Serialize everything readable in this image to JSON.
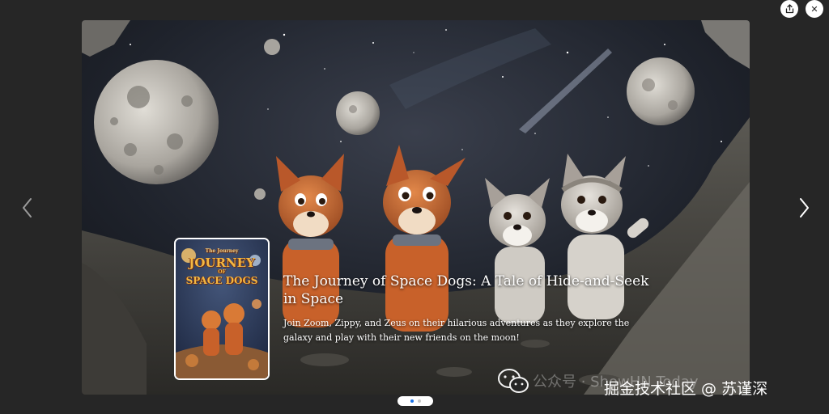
{
  "toolbar": {
    "share_icon": "share-icon",
    "close_icon": "close-icon",
    "close_glyph": "✕"
  },
  "navigation": {
    "prev_icon": "chevron-left-icon",
    "next_icon": "chevron-right-icon"
  },
  "slide": {
    "cover": {
      "line1": "The Journey",
      "line2": "JOURNEY",
      "line3": "OF",
      "line4": "SPACE DOGS"
    },
    "title": "The Journey of Space Dogs: A Tale of Hide-and-Seek in Space",
    "description": "Join Zoom, Zippy, and Zeus on their hilarious adventures as they explore the galaxy and play with their new friends on the moon!"
  },
  "pager": {
    "total": 2,
    "active_index": 0
  },
  "watermark": {
    "wechat_icon": "wechat-icon",
    "account": "公众号 · ShowHN Today",
    "site": "掘金技术社区 @ 苏谨深"
  }
}
